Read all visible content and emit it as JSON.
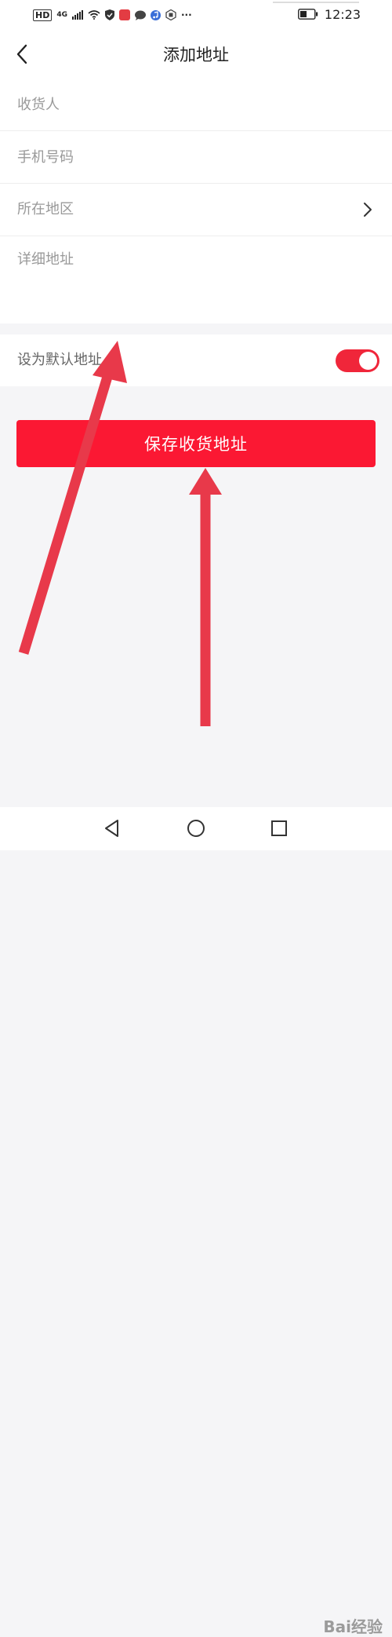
{
  "status": {
    "hd": "HD",
    "network": "4G",
    "dots": "···",
    "time": "12:23"
  },
  "header": {
    "title": "添加地址"
  },
  "form": {
    "recipient_placeholder": "收货人",
    "phone_placeholder": "手机号码",
    "region_label": "所在地区",
    "detail_placeholder": "详细地址"
  },
  "default_address": {
    "label": "设为默认地址",
    "enabled": true
  },
  "actions": {
    "save_label": "保存收货地址"
  },
  "watermark": {
    "text": "Bai经验"
  },
  "colors": {
    "accent": "#fb1833",
    "toggle": "#f0263a",
    "arrow": "#e8394a"
  }
}
